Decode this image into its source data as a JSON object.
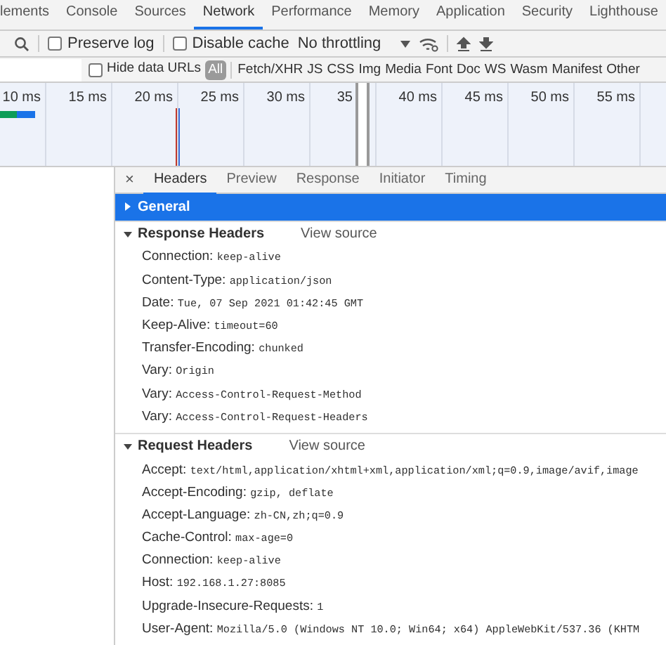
{
  "main_tabs": [
    {
      "label": "lements",
      "selected": false
    },
    {
      "label": "Console",
      "selected": false
    },
    {
      "label": "Sources",
      "selected": false
    },
    {
      "label": "Network",
      "selected": true
    },
    {
      "label": "Performance",
      "selected": false
    },
    {
      "label": "Memory",
      "selected": false
    },
    {
      "label": "Application",
      "selected": false
    },
    {
      "label": "Security",
      "selected": false
    },
    {
      "label": "Lighthouse",
      "selected": false
    }
  ],
  "toolbar": {
    "preserve_log": {
      "label": "Preserve log",
      "checked": false
    },
    "disable_cache": {
      "label": "Disable cache",
      "checked": false
    },
    "throttling": "No throttling"
  },
  "filters": {
    "hide_data_urls": {
      "label": "Hide data URLs",
      "checked": false
    },
    "types": [
      {
        "label": "All",
        "selected": true
      },
      {
        "label": "Fetch/XHR",
        "selected": false
      },
      {
        "label": "JS",
        "selected": false
      },
      {
        "label": "CSS",
        "selected": false
      },
      {
        "label": "Img",
        "selected": false
      },
      {
        "label": "Media",
        "selected": false
      },
      {
        "label": "Font",
        "selected": false
      },
      {
        "label": "Doc",
        "selected": false
      },
      {
        "label": "WS",
        "selected": false
      },
      {
        "label": "Wasm",
        "selected": false
      },
      {
        "label": "Manifest",
        "selected": false
      },
      {
        "label": "Other",
        "selected": false
      }
    ]
  },
  "timeline": {
    "ticks": [
      "10 ms",
      "15 ms",
      "20 ms",
      "25 ms",
      "30 ms",
      "35",
      "40 ms",
      "45 ms",
      "50 ms",
      "55 ms"
    ]
  },
  "close_label": "×",
  "detail_tabs": [
    {
      "label": "Headers",
      "selected": true
    },
    {
      "label": "Preview",
      "selected": false
    },
    {
      "label": "Response",
      "selected": false
    },
    {
      "label": "Initiator",
      "selected": false
    },
    {
      "label": "Timing",
      "selected": false
    }
  ],
  "sections": [
    {
      "title": "General",
      "expanded": false,
      "highlighted": true
    },
    {
      "title": "Response Headers",
      "expanded": true,
      "highlighted": false,
      "link": "View source",
      "headers": [
        {
          "name": "Connection:",
          "value": "keep-alive"
        },
        {
          "name": "Content-Type:",
          "value": "application/json"
        },
        {
          "name": "Date:",
          "value": "Tue, 07 Sep 2021 01:42:45 GMT"
        },
        {
          "name": "Keep-Alive:",
          "value": "timeout=60"
        },
        {
          "name": "Transfer-Encoding:",
          "value": "chunked"
        },
        {
          "name": "Vary:",
          "value": "Origin"
        },
        {
          "name": "Vary:",
          "value": "Access-Control-Request-Method"
        },
        {
          "name": "Vary:",
          "value": "Access-Control-Request-Headers"
        }
      ]
    },
    {
      "title": "Request Headers",
      "expanded": true,
      "highlighted": false,
      "link": "View source",
      "headers": [
        {
          "name": "Accept:",
          "value": "text/html,application/xhtml+xml,application/xml;q=0.9,image/avif,image"
        },
        {
          "name": "Accept-Encoding:",
          "value": "gzip, deflate"
        },
        {
          "name": "Accept-Language:",
          "value": "zh-CN,zh;q=0.9"
        },
        {
          "name": "Cache-Control:",
          "value": "max-age=0"
        },
        {
          "name": "Connection:",
          "value": "keep-alive"
        },
        {
          "name": "Host:",
          "value": "192.168.1.27:8085"
        },
        {
          "name": "Upgrade-Insecure-Requests:",
          "value": "1"
        },
        {
          "name": "User-Agent:",
          "value": "Mozilla/5.0 (Windows NT 10.0; Win64; x64) AppleWebKit/537.36 (KHTM"
        }
      ]
    }
  ]
}
